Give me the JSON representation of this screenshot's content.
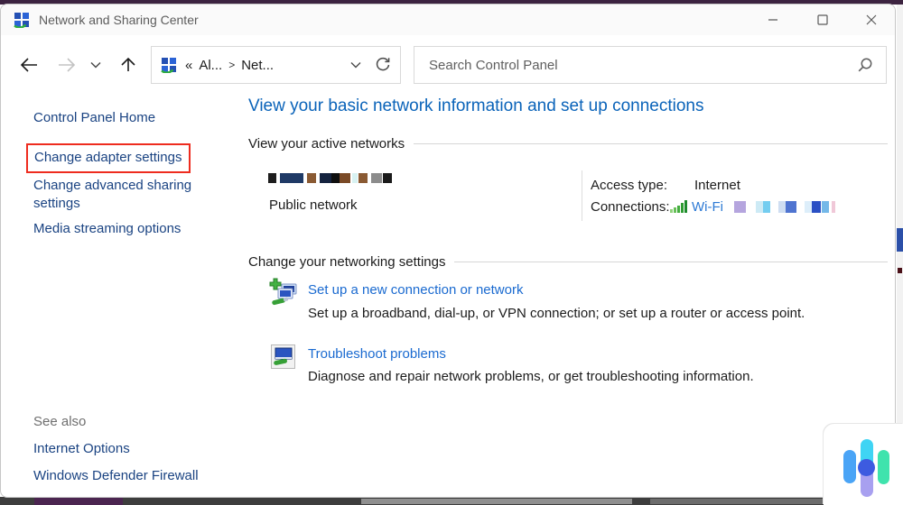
{
  "colors": {
    "heading_blue": "#0a63b9",
    "link_blue": "#1a6ad0",
    "wifi_link_blue": "#2c79d4",
    "sidebar_navy": "#1a4382",
    "text_dark": "#1c1c1c",
    "muted_gray": "#6f6f6f",
    "titlebar_text": "#5c5c5c",
    "highlight_red": "#ee2c1f",
    "border_gray": "#d9d9d9",
    "rule_gray": "#d6d6d6",
    "desktop_purple": "#3c2340",
    "taskbar_dark": "#3d3d3d"
  },
  "window": {
    "title": "Network and Sharing Center"
  },
  "toolbar": {
    "breadcrumb": {
      "collapse_glyph": "«",
      "separator": ">",
      "items": [
        {
          "label": "Al..."
        },
        {
          "label": "Net..."
        }
      ]
    },
    "search": {
      "placeholder": "Search Control Panel"
    }
  },
  "sidebar": {
    "home_link": "Control Panel Home",
    "links": [
      {
        "label": "Change adapter settings",
        "highlighted": true
      },
      {
        "label": "Change advanced sharing settings",
        "highlighted": false
      },
      {
        "label": "Media streaming options",
        "highlighted": false
      }
    ],
    "see_also": {
      "heading": "See also",
      "links": [
        {
          "label": "Internet Options"
        },
        {
          "label": "Windows Defender Firewall"
        }
      ]
    }
  },
  "main": {
    "heading": "View your basic network information and set up connections",
    "active_networks": {
      "section_label": "View your active networks",
      "network": {
        "name_redacted_blocks": [
          [
            9,
            "#1d1d1d"
          ],
          [
            4,
            ""
          ],
          [
            26,
            "#1f3a66"
          ],
          [
            4,
            ""
          ],
          [
            10,
            "#8a5a33"
          ],
          [
            4,
            ""
          ],
          [
            13,
            "#15233f"
          ],
          [
            9,
            "#0f0f0f"
          ],
          [
            12,
            "#7a4a26"
          ],
          [
            2,
            ""
          ],
          [
            6,
            "#d8f2f2"
          ],
          [
            1,
            ""
          ],
          [
            10,
            "#8a5a33"
          ],
          [
            4,
            ""
          ],
          [
            12,
            "#8c8c8c"
          ],
          [
            1,
            ""
          ],
          [
            10,
            "#1a1a1a"
          ]
        ],
        "profile": "Public network",
        "access_type_label": "Access type:",
        "access_type_value": "Internet",
        "connections_label": "Connections:",
        "connection_link": "Wi-Fi",
        "ssid_redacted_blocks": [
          [
            13,
            "#b5a5de"
          ],
          [
            11,
            ""
          ],
          [
            8,
            "#cdeaf5"
          ],
          [
            8,
            "#74cdf0"
          ],
          [
            9,
            ""
          ],
          [
            8,
            "#cfdef2"
          ],
          [
            12,
            "#4f74d0"
          ],
          [
            9,
            ""
          ],
          [
            8,
            "#ddeefa"
          ],
          [
            10,
            "#2b50c4"
          ],
          [
            1,
            ""
          ],
          [
            8,
            "#74b8e8"
          ],
          [
            3,
            ""
          ],
          [
            4,
            "#f0c8d8"
          ]
        ]
      }
    },
    "settings": {
      "section_label": "Change your networking settings",
      "tasks": [
        {
          "title": "Set up a new connection or network",
          "description": "Set up a broadband, dial-up, or VPN connection; or set up a router or access point."
        },
        {
          "title": "Troubleshoot problems",
          "description": "Diagnose and repair network problems, or get troubleshooting information."
        }
      ]
    }
  }
}
